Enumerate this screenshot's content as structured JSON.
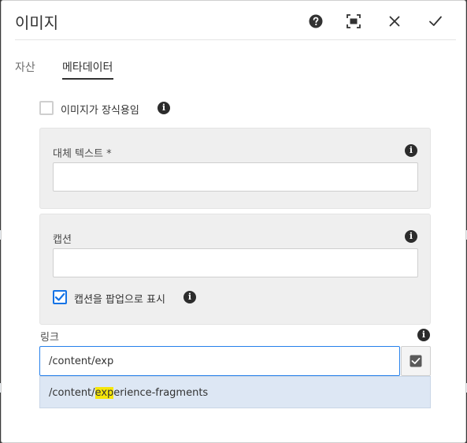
{
  "dialog": {
    "title": "이미지",
    "actions": {
      "help_icon": "help-icon",
      "fullscreen_icon": "fullscreen-icon",
      "close_icon": "close-icon",
      "confirm_icon": "checkmark-icon"
    }
  },
  "tabs": [
    {
      "label": "자산",
      "active": false
    },
    {
      "label": "메타데이터",
      "active": true
    }
  ],
  "decorative": {
    "label": "이미지가 장식용임",
    "checked": false
  },
  "alt_text": {
    "label": "대체 텍스트 *",
    "value": ""
  },
  "caption": {
    "label": "캡션",
    "value": "",
    "popup_label": "캡션을 팝업으로 표시",
    "popup_checked": true
  },
  "link": {
    "label": "링크",
    "value": "/content/exp",
    "suggestion": {
      "prefix": "/content/",
      "match": "exp",
      "suffix": "erience-fragments"
    }
  },
  "colors": {
    "accent": "#1473e6",
    "highlight": "#f6e60a",
    "suggestion_bg": "#dde7f4"
  }
}
